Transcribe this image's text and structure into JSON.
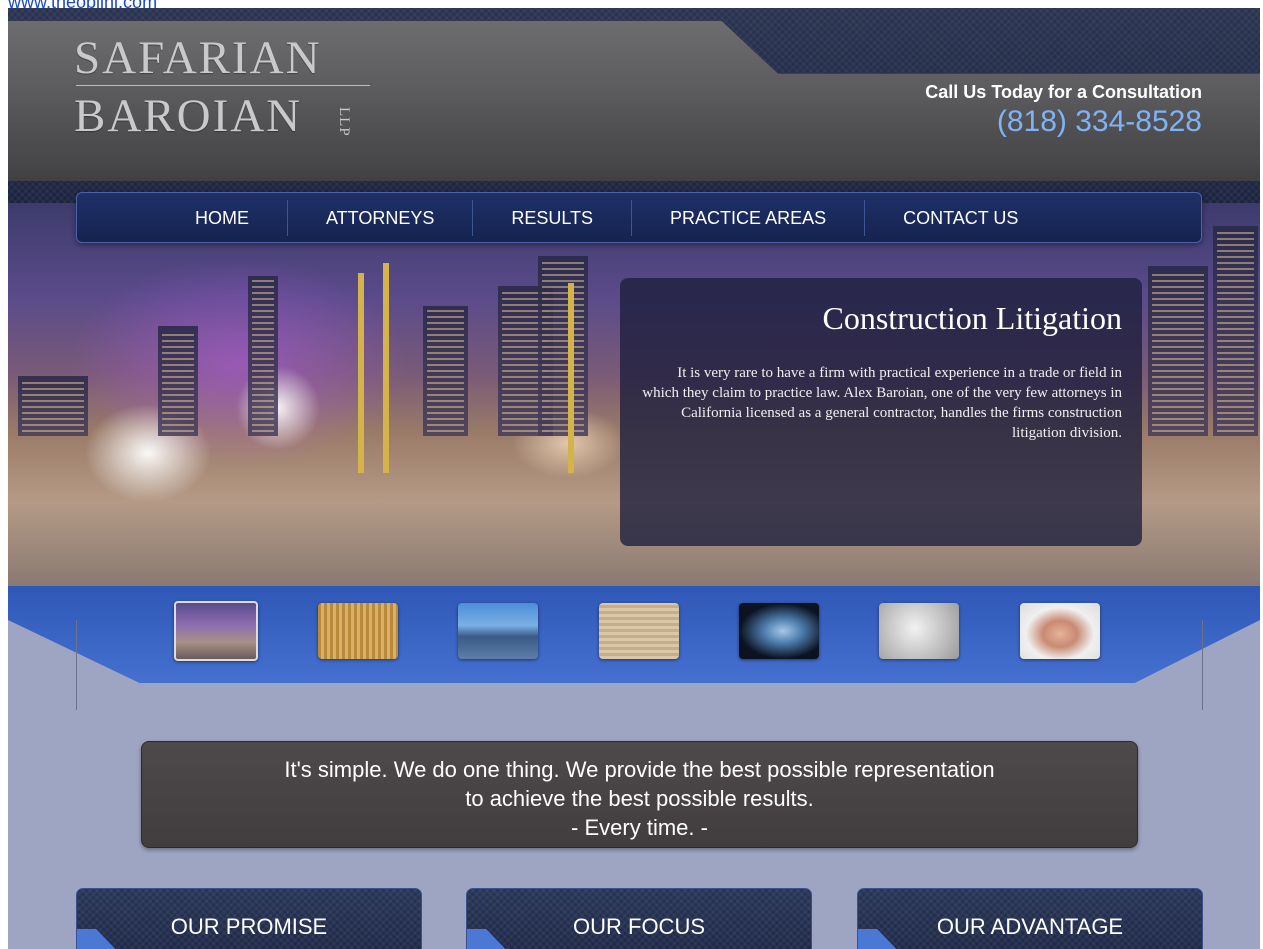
{
  "top_link": "www.theoblinl.com",
  "header": {
    "logo_line1": "SAFARIAN",
    "logo_line2": "BAROIAN",
    "logo_suffix": "LLP",
    "cta_label": "Call Us Today for a Consultation",
    "cta_phone": "(818) 334-8528"
  },
  "nav": {
    "items": [
      {
        "label": "HOME"
      },
      {
        "label": "ATTORNEYS"
      },
      {
        "label": "RESULTS"
      },
      {
        "label": "PRACTICE AREAS"
      },
      {
        "label": "CONTACT US"
      }
    ]
  },
  "hero": {
    "title": "Construction Litigation",
    "text": "It is very rare to have a firm with practical experience in a trade or field in which they claim to practice law. Alex Baroian, one of the very few attorneys in California licensed as a general contractor, handles the firms construction litigation division."
  },
  "thumbnails": {
    "selected_index": 0,
    "items": [
      {
        "icon": "construction-site-thumb"
      },
      {
        "icon": "courthouse-thumb"
      },
      {
        "icon": "shipping-port-thumb"
      },
      {
        "icon": "map-thumb"
      },
      {
        "icon": "xray-skull-thumb"
      },
      {
        "icon": "magnifier-document-thumb"
      },
      {
        "icon": "handshake-thumb"
      }
    ]
  },
  "tagline": {
    "line1": "It's simple. We do one thing. We provide the best possible representation",
    "line2": "to achieve the best possible results.",
    "line3": "- Every time. -"
  },
  "tabs": [
    {
      "label": "OUR PROMISE"
    },
    {
      "label": "OUR FOCUS"
    },
    {
      "label": "OUR ADVANTAGE"
    }
  ],
  "colors": {
    "nav_bg": "#1b2a5c",
    "phone_accent": "#7fb3f5",
    "band_blue": "#3c67c6",
    "page_bg": "#9ea5c2",
    "tagline_bg": "#474344"
  }
}
